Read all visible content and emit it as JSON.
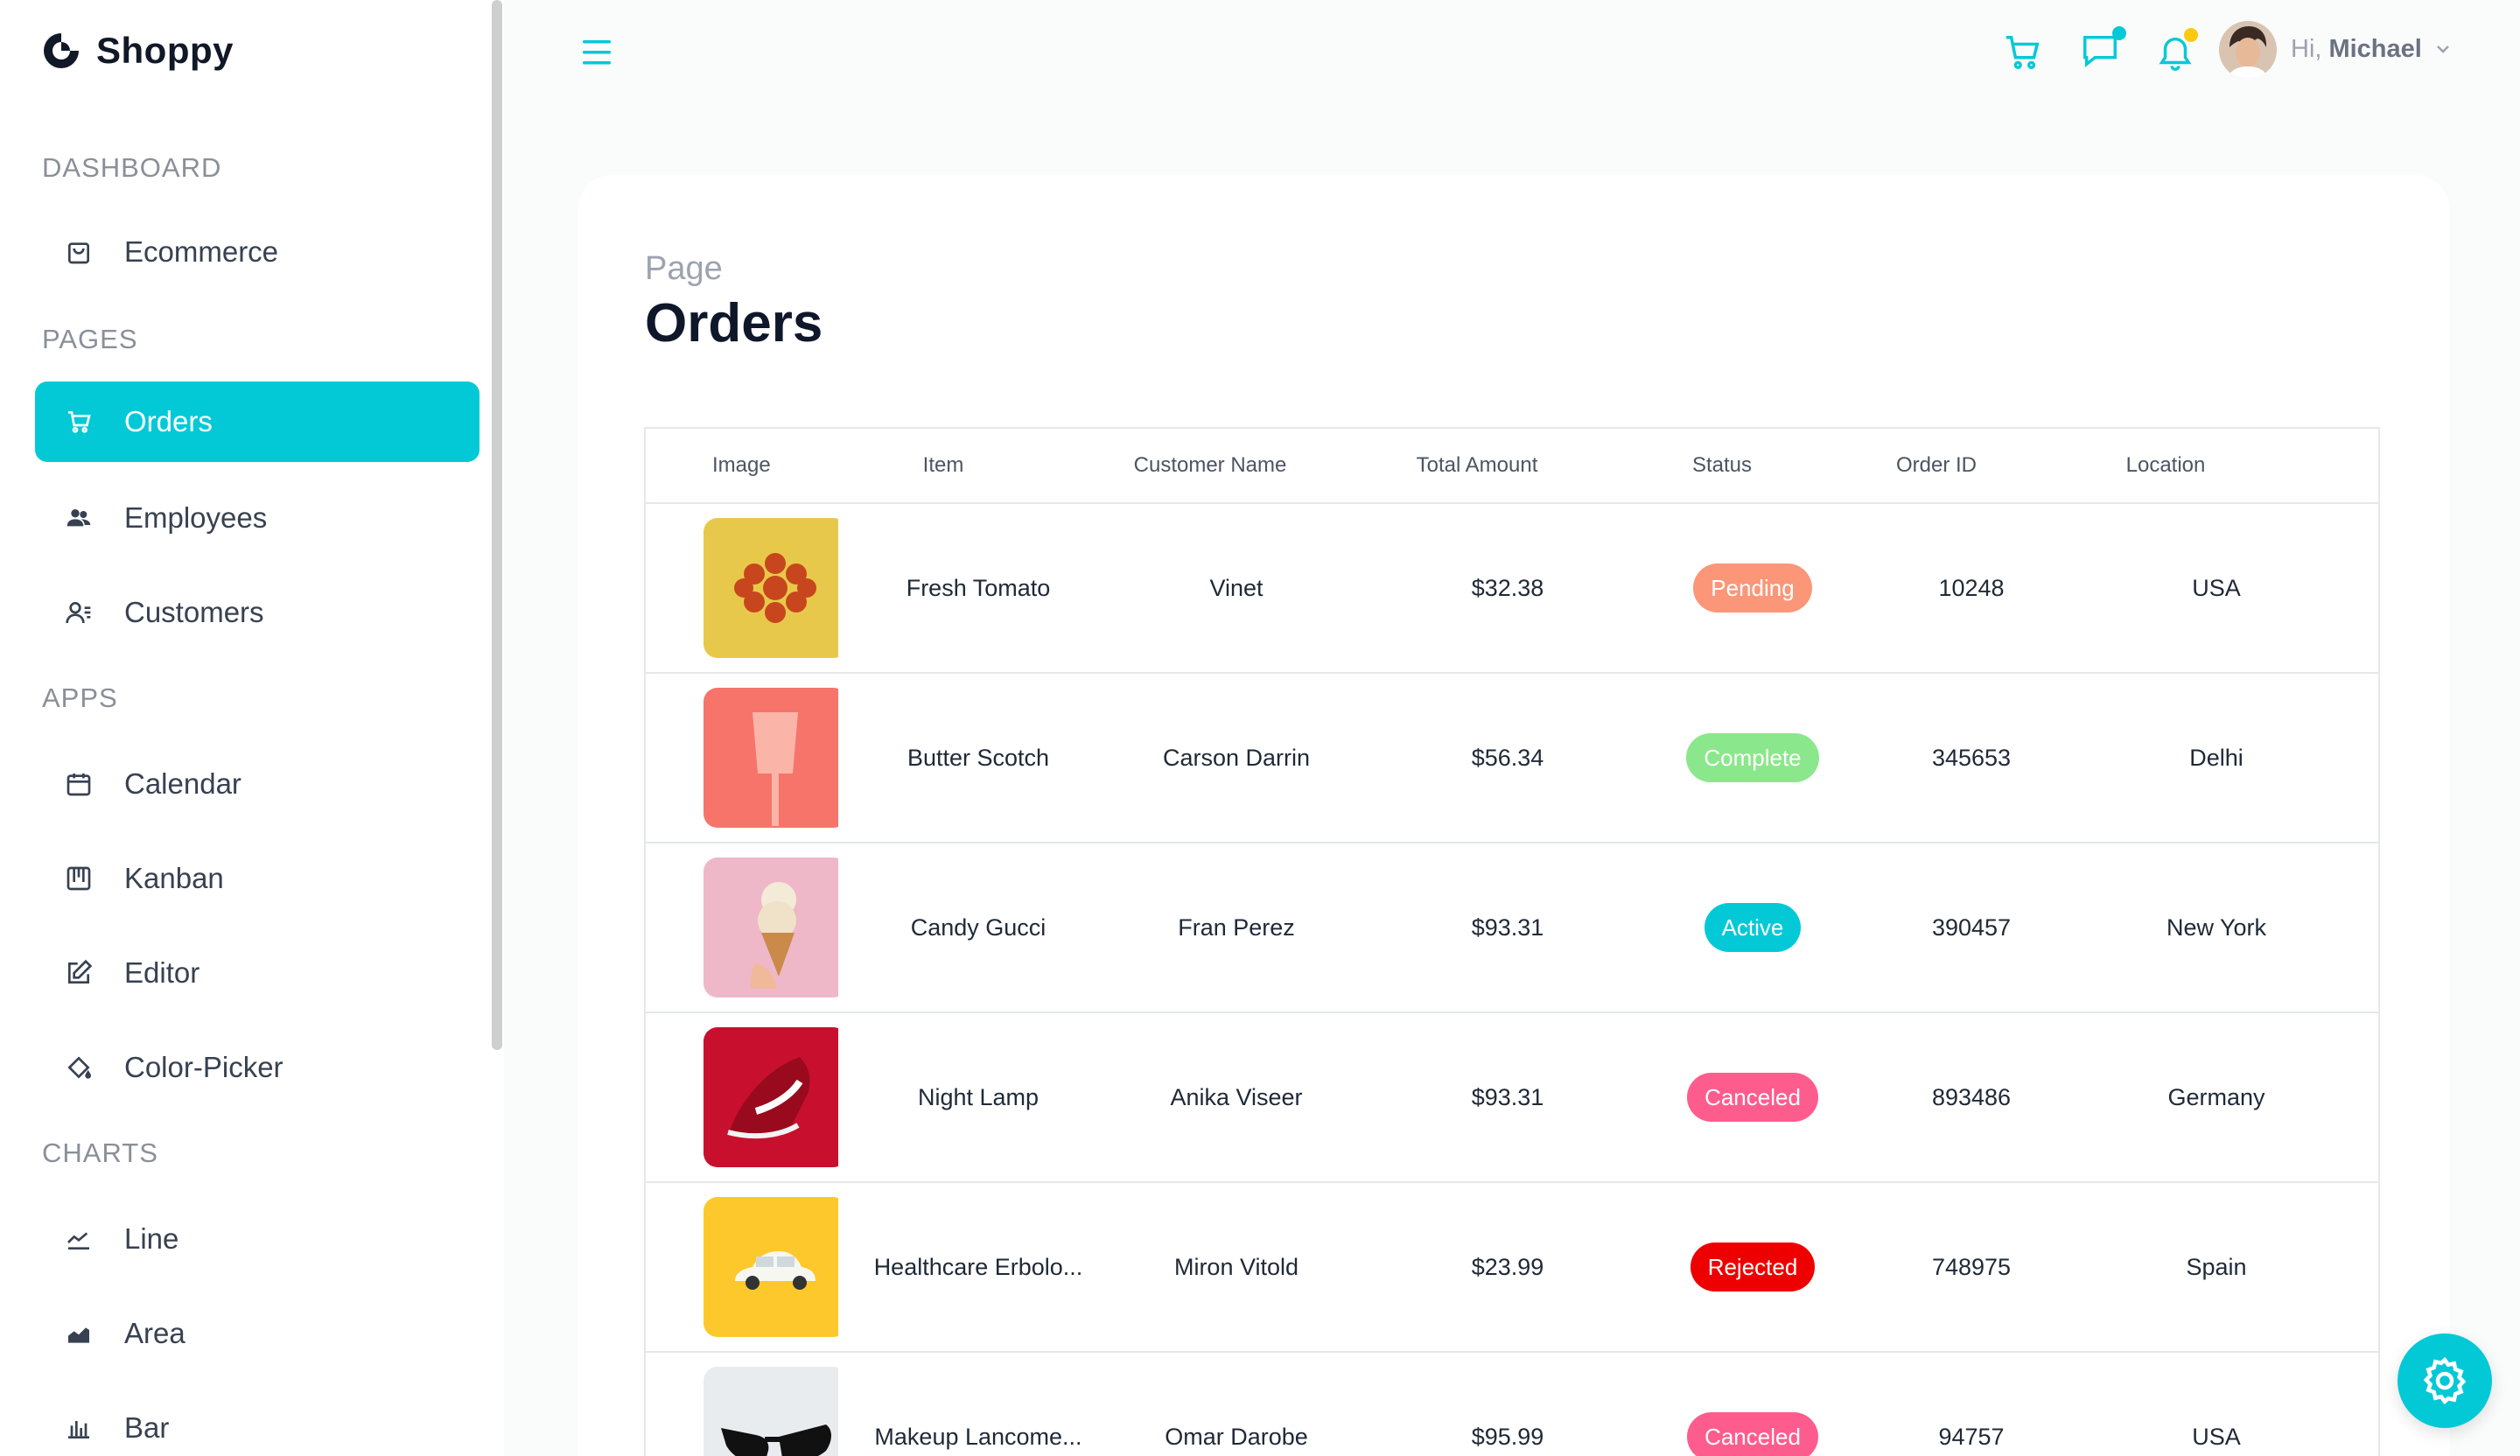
{
  "brand": {
    "name": "Shoppy"
  },
  "sidebar": {
    "sections": {
      "dashboard": "DASHBOARD",
      "pages": "PAGES",
      "apps": "APPS",
      "charts": "CHARTS"
    },
    "items": [
      {
        "label": "Ecommerce",
        "icon": "shopping-bag-icon"
      },
      {
        "label": "Orders",
        "icon": "cart-icon",
        "active": true
      },
      {
        "label": "Employees",
        "icon": "people-icon"
      },
      {
        "label": "Customers",
        "icon": "customers-icon"
      },
      {
        "label": "Calendar",
        "icon": "calendar-icon"
      },
      {
        "label": "Kanban",
        "icon": "kanban-icon"
      },
      {
        "label": "Editor",
        "icon": "edit-icon"
      },
      {
        "label": "Color-Picker",
        "icon": "paint-bucket-icon"
      },
      {
        "label": "Line",
        "icon": "line-chart-icon"
      },
      {
        "label": "Area",
        "icon": "area-chart-icon"
      },
      {
        "label": "Bar",
        "icon": "bar-chart-icon"
      }
    ]
  },
  "topbar": {
    "greeting": "Hi,",
    "user_name": "Michael",
    "icons": [
      "menu-icon",
      "cart-icon",
      "chat-icon",
      "bell-icon",
      "chevron-down-icon"
    ]
  },
  "page": {
    "subtitle": "Page",
    "title": "Orders"
  },
  "orders": {
    "columns": [
      "Image",
      "Item",
      "Customer Name",
      "Total Amount",
      "Status",
      "Order ID",
      "Location"
    ],
    "rows": [
      {
        "item": "Fresh Tomato",
        "customer": "Vinet",
        "amount": "$32.38",
        "status": "Pending",
        "status_color": "#fb9678",
        "order_id": "10248",
        "location": "USA",
        "thumb_bg": "#e8c84a"
      },
      {
        "item": "Butter Scotch",
        "customer": "Carson Darrin",
        "amount": "$56.34",
        "status": "Complete",
        "status_color": "#8be78b",
        "order_id": "345653",
        "location": "Delhi",
        "thumb_bg": "#f7746a"
      },
      {
        "item": "Candy Gucci",
        "customer": "Fran Perez",
        "amount": "$93.31",
        "status": "Active",
        "status_color": "#03c9d7",
        "order_id": "390457",
        "location": "New York",
        "thumb_bg": "#efb8c8"
      },
      {
        "item": "Night Lamp",
        "customer": "Anika Viseer",
        "amount": "$93.31",
        "status": "Canceled",
        "status_color": "#ff5c8e",
        "order_id": "893486",
        "location": "Germany",
        "thumb_bg": "#c8102e"
      },
      {
        "item": "Healthcare Erbolo...",
        "customer": "Miron Vitold",
        "amount": "$23.99",
        "status": "Rejected",
        "status_color": "#ef0000",
        "order_id": "748975",
        "location": "Spain",
        "thumb_bg": "#fdc82b"
      },
      {
        "item": "Makeup Lancome...",
        "customer": "Omar Darobe",
        "amount": "$95.99",
        "status": "Canceled",
        "status_color": "#ff5c8e",
        "order_id": "94757",
        "location": "USA",
        "thumb_bg": "#e9ecef"
      }
    ]
  },
  "colors": {
    "accent": "#03c9d7",
    "dot_chat": "#03c9d7",
    "dot_bell": "#fec90f"
  }
}
